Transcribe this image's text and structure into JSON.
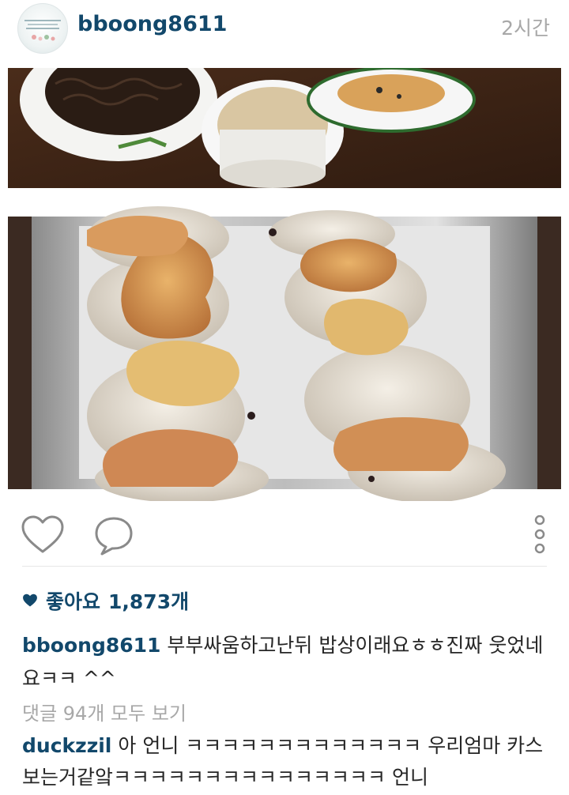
{
  "post": {
    "username": "bboong8611",
    "time": "2시간",
    "likes_label": "좋아요",
    "likes_count": "1,873개",
    "caption_username": "bboong8611",
    "caption_text": "부부싸움하고난뒤 밥상이래요ㅎㅎ진짜 웃었네요ㅋㅋ ^^",
    "view_all_comments": "댓글 94개 모두 보기",
    "comment_username": "duckzzil",
    "comment_text": "아 언니 ㅋㅋㅋㅋㅋㅋㅋㅋㅋㅋㅋㅋㅋ 우리엄마 카스 보는거같앜ㅋㅋㅋㅋㅋㅋㅋㅋㅋㅋㅋㅋㅋㅋㅋ 언니"
  },
  "icons": {
    "like": "heart-outline-icon",
    "comment": "speech-bubble-icon",
    "more": "vertical-dots-icon",
    "likes_heart": "heart-filled-icon"
  },
  "colors": {
    "username": "#12486b",
    "meta": "#a8a8a8",
    "text": "#262626"
  }
}
